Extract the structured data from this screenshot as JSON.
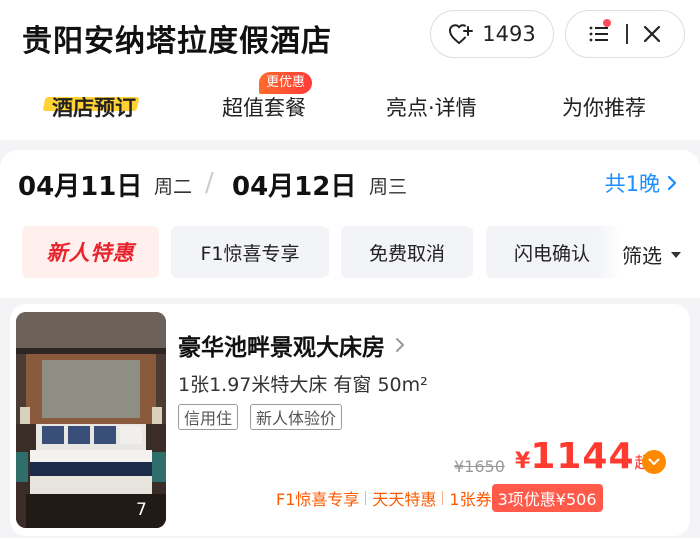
{
  "header": {
    "title": "贵阳安纳塔拉度假酒店",
    "favorite_count": "1493",
    "favorite_icon": "heart-plus-icon",
    "menu_icon": "list-menu-icon",
    "close_icon": "close-icon"
  },
  "tabs": [
    {
      "label": "酒店预订",
      "active": true
    },
    {
      "label": "超值套餐",
      "badge": "更优惠"
    },
    {
      "label": "亮点·详情"
    },
    {
      "label": "为你推荐"
    }
  ],
  "dates": {
    "checkin": "04月11日",
    "checkin_weekday": "周二",
    "checkout": "04月12日",
    "checkout_weekday": "周三",
    "separator": "/",
    "nights": "共1晚"
  },
  "filters": {
    "special": "新人特惠",
    "chips": [
      "F1惊喜专享",
      "免费取消",
      "闪电确认"
    ],
    "filter_label": "筛选"
  },
  "room": {
    "name": "豪华池畔景观大床房",
    "specs": "1张1.97米特大床  有窗  50m²",
    "tags": [
      "信用住",
      "新人体验价"
    ],
    "photo_count": "7",
    "original_price": "¥1650",
    "currency": "¥",
    "price": "1144",
    "price_suffix": "起",
    "promos": [
      "F1惊喜专享",
      "天天特惠",
      "1张券"
    ],
    "discount_label": "3项优惠¥506"
  },
  "colors": {
    "accent_yellow": "#ffd236",
    "price_red": "#ff3b30",
    "link_blue": "#1a8eff",
    "promo_orange": "#ff5a00"
  }
}
